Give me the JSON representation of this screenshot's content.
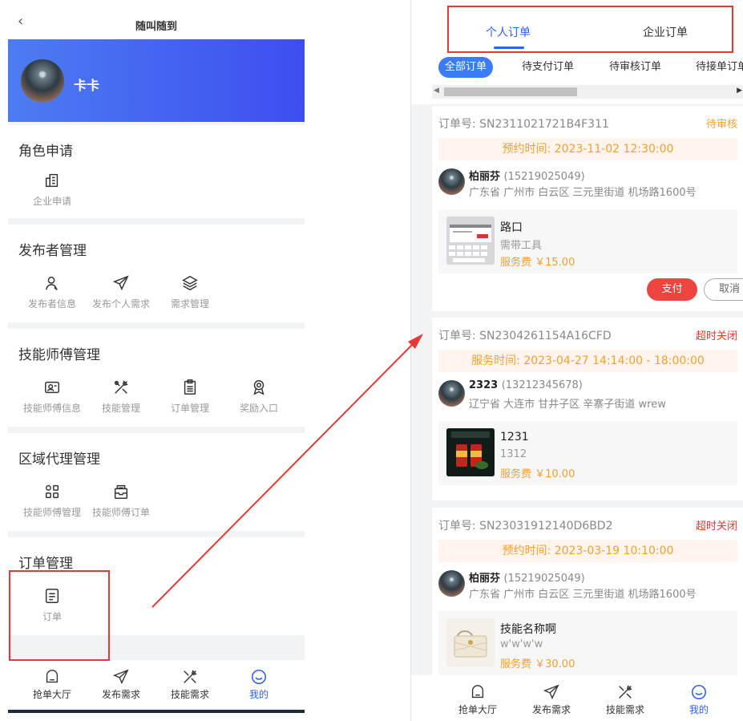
{
  "left": {
    "title": "随叫随到",
    "back_icon": "chevron-left-icon",
    "user_name": "卡卡",
    "sections": [
      {
        "title": "角色申请",
        "items": [
          {
            "label": "企业申请",
            "icon": "building-icon"
          }
        ]
      },
      {
        "title": "发布者管理",
        "items": [
          {
            "label": "发布者信息",
            "icon": "user-icon"
          },
          {
            "label": "发布个人需求",
            "icon": "send-icon"
          },
          {
            "label": "需求管理",
            "icon": "layers-icon"
          }
        ]
      },
      {
        "title": "技能师傅管理",
        "items": [
          {
            "label": "技能师傅信息",
            "icon": "id-card-icon"
          },
          {
            "label": "技能管理",
            "icon": "tools-icon"
          },
          {
            "label": "订单管理",
            "icon": "clipboard-icon"
          },
          {
            "label": "奖励入口",
            "icon": "award-icon"
          }
        ]
      },
      {
        "title": "区域代理管理",
        "items": [
          {
            "label": "技能师傅管理",
            "icon": "grid-icon"
          },
          {
            "label": "技能师傅订单",
            "icon": "inbox-icon"
          }
        ]
      },
      {
        "title": "订单管理",
        "items": [
          {
            "label": "订单",
            "icon": "document-icon"
          }
        ]
      }
    ],
    "tabbar": [
      {
        "label": "抢单大厅",
        "icon": "home-icon"
      },
      {
        "label": "发布需求",
        "icon": "send-icon"
      },
      {
        "label": "技能需求",
        "icon": "tools-icon"
      },
      {
        "label": "我的",
        "icon": "smile-icon"
      }
    ]
  },
  "right": {
    "top_tabs": [
      "个人订单",
      "企业订单"
    ],
    "active_top_tab": 0,
    "filters": [
      "全部订单",
      "待支付订单",
      "待审核订单",
      "待接单订单"
    ],
    "active_filter": 0,
    "orders": [
      {
        "order_no": "订单号: SN2311021721B4F311",
        "status": "待审核",
        "status_color": "#f0a030",
        "time": "预约时间: 2023-11-02 12:30:00",
        "name": "柏丽芬",
        "phone": "(15219025049)",
        "address": "广东省 广州市 白云区 三元里街道 机场路1600号",
        "goods_name": "路口",
        "goods_desc": "需带工具",
        "fee": "服务费 ￥15.00",
        "buttons": [
          "支付",
          "取消"
        ]
      },
      {
        "order_no": "订单号: SN2304261154A16CFD",
        "status": "超时关闭",
        "status_color": "#e53935",
        "time": "服务时间: 2023-04-27 14:14:00 - 18:00:00",
        "name": "2323",
        "phone": "(13212345678)",
        "address": "辽宁省 大连市 甘井子区 辛寨子街道 wrew",
        "goods_name": "1231",
        "goods_desc": "1312",
        "fee": "服务费 ￥10.00"
      },
      {
        "order_no": "订单号: SN23031912140D6BD2",
        "status": "超时关闭",
        "status_color": "#e53935",
        "time": "预约时间: 2023-03-19 10:10:00",
        "name": "柏丽芬",
        "phone": "(15219025049)",
        "address": "广东省 广州市 白云区 三元里街道 机场路1600号",
        "goods_name": "技能名称啊",
        "goods_desc": "w'w'w'w",
        "fee": "服务费 ￥30.00"
      }
    ],
    "tabbar": [
      {
        "label": "抢单大厅",
        "icon": "home-icon"
      },
      {
        "label": "发布需求",
        "icon": "send-icon"
      },
      {
        "label": "技能需求",
        "icon": "tools-icon"
      },
      {
        "label": "我的",
        "icon": "smile-icon"
      }
    ],
    "active_tab": 3
  },
  "colors": {
    "accent": "#3060f0",
    "highlight_box": "#e53935",
    "warning": "#f0a030",
    "danger": "#e53935"
  }
}
